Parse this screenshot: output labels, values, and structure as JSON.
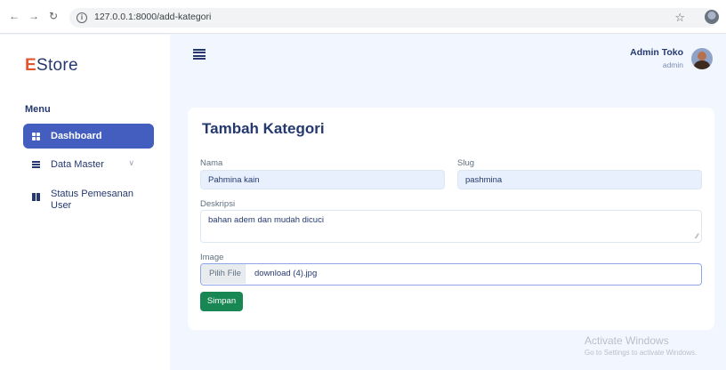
{
  "browser": {
    "url": "127.0.0.1:8000/add-kategori"
  },
  "sidebar": {
    "brand_first": "E",
    "brand_rest": "Store",
    "menu_title": "Menu",
    "items": [
      {
        "label": "Dashboard",
        "icon": "grid-icon",
        "active": true
      },
      {
        "label": "Data Master",
        "icon": "stack-icon",
        "has_submenu": true
      },
      {
        "label_line1": "Status Pemesanan",
        "label_line2": "User",
        "icon": "layout-icon"
      }
    ]
  },
  "topbar": {
    "user_name": "Admin Toko",
    "user_role": "admin"
  },
  "form": {
    "title": "Tambah Kategori",
    "nama_label": "Nama",
    "nama_value": "Pahmina kain",
    "slug_label": "Slug",
    "slug_value": "pashmina",
    "deskripsi_label": "Deskripsi",
    "deskripsi_value": "bahan adem dan mudah dicuci",
    "image_label": "Image",
    "file_button": "Pilih File",
    "file_name": "download (4).jpg",
    "submit_label": "Simpan"
  },
  "colors": {
    "accent": "#435ebe",
    "brand_e": "#e4552d",
    "submit": "#198754",
    "background": "#f2f7ff"
  },
  "watermark": {
    "title": "Activate Windows",
    "subtitle": "Go to Settings to activate Windows."
  }
}
